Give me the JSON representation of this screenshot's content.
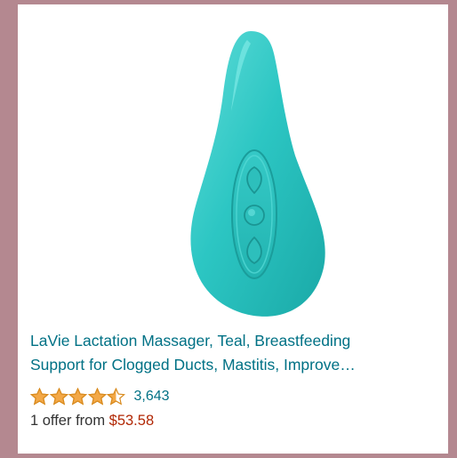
{
  "product": {
    "image_icon": "teal-lactation-massager-product-image",
    "title_line1": "LaVie Lactation Massager, Teal, Breastfeeding",
    "title_line2": "Support for Clogged Ducts, Mastitis, Improve…",
    "rating": 4.5,
    "rating_max": 5,
    "review_count": "3,643",
    "offer_prefix": "1 offer from ",
    "offer_price": "$53.58"
  },
  "colors": {
    "background": "#b48890",
    "card": "#ffffff",
    "product_teal": "#2ec4c2",
    "link": "#007185",
    "star": "#f3a847",
    "price": "#b12704"
  }
}
